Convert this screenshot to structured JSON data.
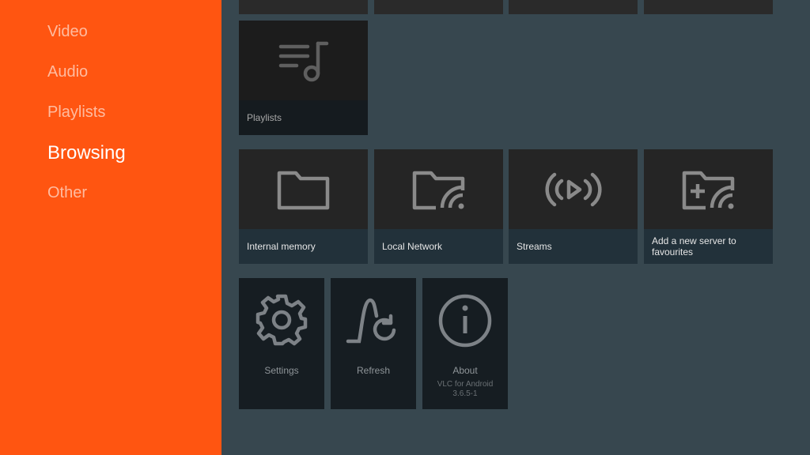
{
  "sidebar": {
    "items": [
      {
        "label": "Video"
      },
      {
        "label": "Audio"
      },
      {
        "label": "Playlists"
      },
      {
        "label": "Browsing",
        "active": true
      },
      {
        "label": "Other"
      }
    ]
  },
  "playlists_section": {
    "cards": [
      {
        "label": "Playlists",
        "icon": "playlist-music-icon"
      }
    ]
  },
  "browsing_section": {
    "cards": [
      {
        "label": "Internal memory",
        "icon": "folder-icon"
      },
      {
        "label": "Local Network",
        "icon": "folder-network-icon"
      },
      {
        "label": "Streams",
        "icon": "stream-icon"
      },
      {
        "label": "Add a new server to favourites",
        "icon": "folder-add-network-icon"
      }
    ]
  },
  "other_section": {
    "cards": [
      {
        "label": "Settings",
        "icon": "gear-icon"
      },
      {
        "label": "Refresh",
        "icon": "refresh-icon"
      },
      {
        "label": "About",
        "icon": "info-icon",
        "subtitle_line1": "VLC for Android",
        "subtitle_line2": "3.6.5-1"
      }
    ]
  },
  "colors": {
    "sidebar_bg": "#ff5511",
    "content_bg": "#37474f",
    "icon_gray": "#8a8a8a"
  }
}
